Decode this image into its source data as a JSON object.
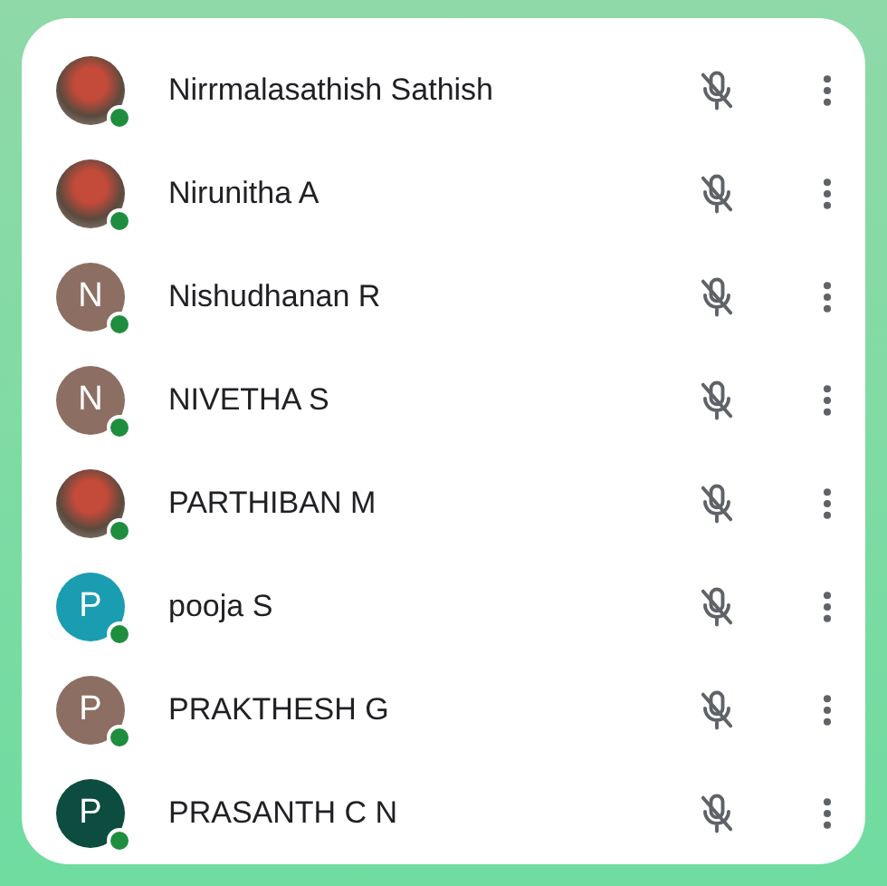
{
  "participants": [
    {
      "name": "Nirrmalasathish Sathish",
      "avatar": {
        "kind": "photo"
      },
      "online": true,
      "muted": true
    },
    {
      "name": "Nirunitha A",
      "avatar": {
        "kind": "photo"
      },
      "online": true,
      "muted": true
    },
    {
      "name": "Nishudhanan R",
      "avatar": {
        "kind": "letter",
        "letter": "N",
        "color": "#8d6e63"
      },
      "online": true,
      "muted": true
    },
    {
      "name": "NIVETHA S",
      "avatar": {
        "kind": "letter",
        "letter": "N",
        "color": "#8d6e63"
      },
      "online": true,
      "muted": true
    },
    {
      "name": "PARTHIBAN M",
      "avatar": {
        "kind": "photo"
      },
      "online": true,
      "muted": true
    },
    {
      "name": "pooja S",
      "avatar": {
        "kind": "letter",
        "letter": "P",
        "color": "#1a9db0"
      },
      "online": true,
      "muted": true
    },
    {
      "name": "PRAKTHESH G",
      "avatar": {
        "kind": "letter",
        "letter": "P",
        "color": "#8d6e63"
      },
      "online": true,
      "muted": true
    },
    {
      "name": "PRASANTH C N",
      "avatar": {
        "kind": "letter",
        "letter": "P",
        "color": "#0d4d3f"
      },
      "online": true,
      "muted": true
    }
  ]
}
